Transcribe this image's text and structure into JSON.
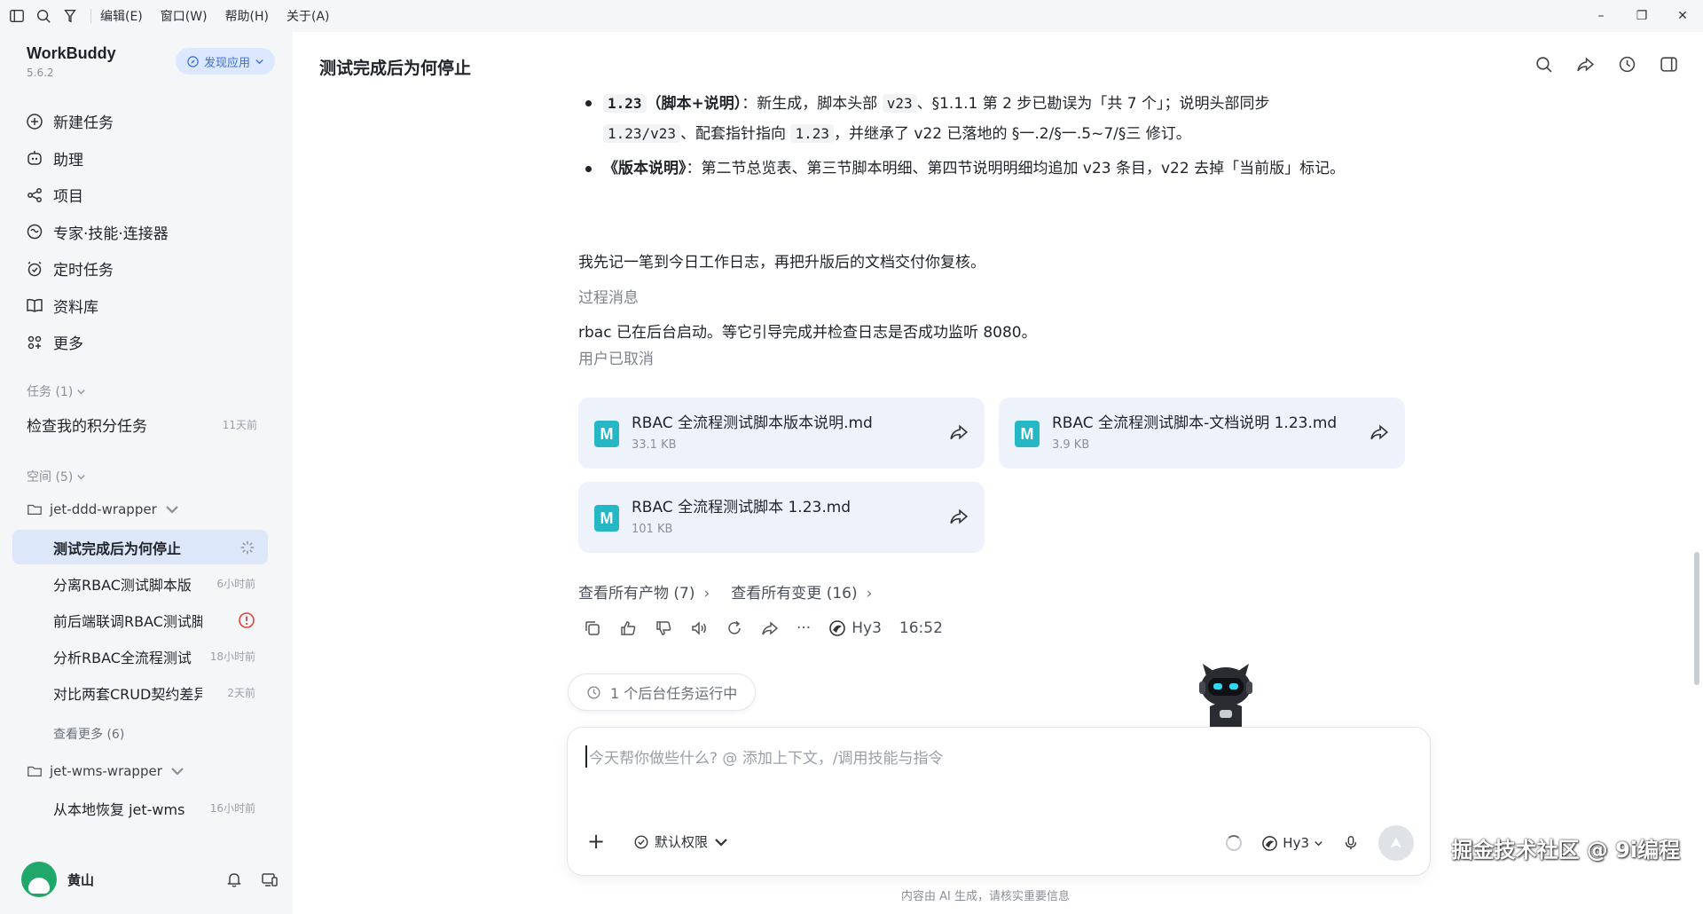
{
  "menu": {
    "items": [
      "编辑(E)",
      "窗口(W)",
      "帮助(H)",
      "关于(A)"
    ]
  },
  "window_controls": {
    "minimize": "–",
    "restore": "❐",
    "close": "✕"
  },
  "sidebar": {
    "app_name": "WorkBuddy",
    "version": "5.6.2",
    "discover_label": "发现应用",
    "nav": [
      {
        "label": "新建任务",
        "icon": "plus-circle-icon"
      },
      {
        "label": "助理",
        "icon": "robot-icon"
      },
      {
        "label": "项目",
        "icon": "share-nodes-icon"
      },
      {
        "label": "专家·技能·连接器",
        "icon": "expert-icon"
      },
      {
        "label": "定时任务",
        "icon": "alarm-clock-icon"
      },
      {
        "label": "资料库",
        "icon": "book-icon"
      },
      {
        "label": "更多",
        "icon": "grid-icon"
      }
    ],
    "tasks_label": "任务 (1)",
    "tasks": [
      {
        "title": "检查我的积分任务",
        "time": "11天前"
      }
    ],
    "spaces_label": "空间 (5)",
    "space1": {
      "name": "jet-ddd-wrapper",
      "conversations": [
        {
          "title": "测试完成后为何停止",
          "time": "",
          "status": "loading"
        },
        {
          "title": "分离RBAC测试脚本版",
          "time": "6小时前"
        },
        {
          "title": "前后端联调RBAC测试脚本",
          "time": "",
          "status": "error"
        },
        {
          "title": "分析RBAC全流程测试",
          "time": "18小时前"
        },
        {
          "title": "对比两套CRUD契约差异",
          "time": "2天前"
        }
      ],
      "see_more": "查看更多 (6)"
    },
    "space2": {
      "name": "jet-wms-wrapper",
      "conversations": [
        {
          "title": "从本地恢复 jet-wms",
          "time": "16小时前"
        }
      ]
    },
    "user_name": "黄山"
  },
  "main": {
    "title": "测试完成后为何停止",
    "bullet1": {
      "b1": "1.23",
      "b2": "（脚本+说明）",
      "t1": "：新生成，脚本头部 ",
      "c1": "v23",
      "t2": "、§1.1.1 第 2 步已勘误为「共 7 个」；说明头部同步",
      "c2": "1.23/v23",
      "t3": "、配套指针指向 ",
      "c3": "1.23",
      "t4": "，并继承了 v22 已落地的 §一.2/§一.5~7/§三 修订。"
    },
    "bullet2": {
      "b1": "《版本说明》",
      "t1": "：第二节总览表、第三节脚本明细、第四节说明明细均追加 v23 条目，v22 去掉「当前版」标记。"
    },
    "para1": "我先记一笔到今日工作日志，再把升版后的文档交付你复核。",
    "process_label": "过程消息",
    "para2": "rbac 已在后台启动。等它引导完成并检查日志是否成功监听 8080。",
    "cancelled": "用户已取消",
    "files": [
      {
        "name": "RBAC 全流程测试脚本版本说明.md",
        "size": "33.1 KB",
        "icon_letter": "M"
      },
      {
        "name": "RBAC 全流程测试脚本-文档说明 1.23.md",
        "size": "3.9 KB",
        "icon_letter": "M"
      },
      {
        "name": "RBAC 全流程测试脚本 1.23.md",
        "size": "101 KB",
        "icon_letter": "M"
      }
    ],
    "view_artifacts": "查看所有产物 (7)",
    "view_changes": "查看所有变更 (16)",
    "chevron": "›",
    "model_tag": "Hy3",
    "timestamp": "16:52",
    "more_dots": "···",
    "bg_task": "1 个后台任务运行中",
    "composer": {
      "placeholder": "今天帮你做些什么? @ 添加上下文，/调用技能与指令",
      "plus": "+",
      "permission": "默认权限",
      "model": "Hy3"
    },
    "disclaimer": "内容由 AI 生成，请核实重要信息",
    "watermark": "掘金技术社区 @ 9i编程"
  },
  "colors": {
    "accent": "#3a6fd8",
    "active_bg": "#dce7f9",
    "file_icon": "#25b8c4",
    "error": "#e0413a"
  }
}
